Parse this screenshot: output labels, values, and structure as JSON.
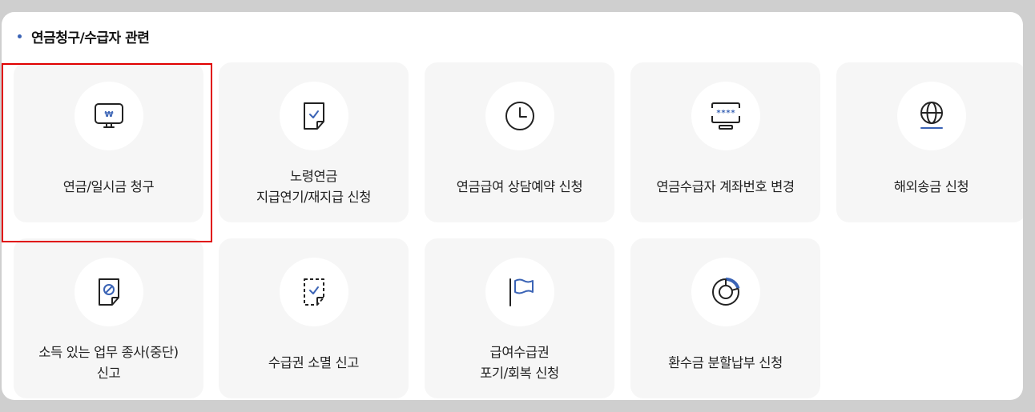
{
  "section": {
    "title": "연금청구/수급자 관련"
  },
  "cards": [
    {
      "icon": "monitor-won-icon",
      "lines": [
        "연금/일시금 청구"
      ]
    },
    {
      "icon": "document-check-icon",
      "lines": [
        "노령연금",
        "지급연기/재지급 신청"
      ]
    },
    {
      "icon": "clock-icon",
      "lines": [
        "연금급여 상담예약 신청"
      ]
    },
    {
      "icon": "password-monitor-icon",
      "lines": [
        "연금수급자 계좌번호 변경"
      ]
    },
    {
      "icon": "globe-icon",
      "lines": [
        "해외송금 신청"
      ]
    },
    {
      "icon": "document-stop-icon",
      "lines": [
        "소득 있는 업무 종사(중단)",
        "신고"
      ]
    },
    {
      "icon": "dashed-document-check-icon",
      "lines": [
        "수급권 소멸 신고"
      ]
    },
    {
      "icon": "flag-icon",
      "lines": [
        "급여수급권",
        "포기/회복 신청"
      ]
    },
    {
      "icon": "donut-chart-icon",
      "lines": [
        "환수금 분할납부 신청"
      ]
    }
  ],
  "icon_text": {
    "won": "₩",
    "password": "****"
  },
  "colors": {
    "accent": "#3a63b5",
    "highlight": "#e00000",
    "card_bg": "#f6f6f6"
  }
}
